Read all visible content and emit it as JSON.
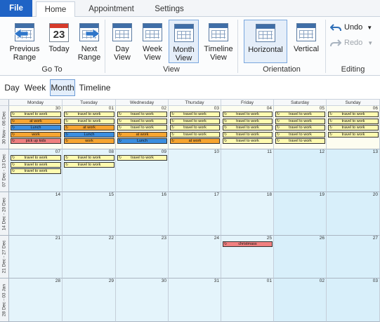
{
  "tabs": {
    "file": "File",
    "home": "Home",
    "appointment": "Appointment",
    "settings": "Settings"
  },
  "ribbon": {
    "goto": {
      "label": "Go To",
      "previous": "Previous Range",
      "today": "Today",
      "today_day": "23",
      "next": "Next Range"
    },
    "view": {
      "label": "View",
      "day": "Day View",
      "week": "Week View",
      "month": "Month View",
      "timeline": "Timeline View"
    },
    "orientation": {
      "label": "Orientation",
      "horizontal": "Horizontal",
      "vertical": "Vertical"
    },
    "editing": {
      "label": "Editing",
      "undo": "Undo",
      "redo": "Redo"
    }
  },
  "switcher": {
    "day": "Day",
    "week": "Week",
    "month": "Month",
    "timeline": "Timeline"
  },
  "calendar": {
    "weekdays": [
      "Monday",
      "Tuesday",
      "Wednesday",
      "Thursday",
      "Friday",
      "Saturday",
      "Sunday"
    ],
    "weeks": [
      {
        "label": "30 Nov - 06 Dec",
        "days": [
          "30",
          "01",
          "02",
          "03",
          "04",
          "05",
          "06"
        ],
        "appts": [
          {
            "day": 0,
            "row": 0,
            "text": "travel to work",
            "color": "#fffbb0"
          },
          {
            "day": 0,
            "row": 1,
            "text": "at work",
            "color": "#f7a531"
          },
          {
            "day": 0,
            "row": 2,
            "text": "Lunch",
            "color": "#3b8ee0"
          },
          {
            "day": 0,
            "row": 3,
            "text": "work",
            "color": "#f7a531"
          },
          {
            "day": 0,
            "row": 4,
            "text": "pick up kids",
            "color": "#f08080"
          },
          {
            "day": 1,
            "row": 0,
            "text": "travel to work",
            "color": "#fffbb0"
          },
          {
            "day": 1,
            "row": 1,
            "text": "travel to work",
            "color": "#fffbb0"
          },
          {
            "day": 1,
            "row": 2,
            "text": "at work",
            "color": "#f7a531"
          },
          {
            "day": 1,
            "row": 3,
            "text": "Lunch",
            "color": "#3b8ee0"
          },
          {
            "day": 1,
            "row": 4,
            "text": "work",
            "color": "#f7a531"
          },
          {
            "day": 2,
            "row": 0,
            "text": "travel to work",
            "color": "#fffbb0"
          },
          {
            "day": 2,
            "row": 1,
            "text": "travel to work",
            "color": "#fffbb0"
          },
          {
            "day": 2,
            "row": 2,
            "text": "travel to work",
            "color": "#fffbb0"
          },
          {
            "day": 2,
            "row": 3,
            "text": "at work",
            "color": "#f7a531"
          },
          {
            "day": 2,
            "row": 4,
            "text": "Lunch",
            "color": "#3b8ee0"
          },
          {
            "day": 3,
            "row": 0,
            "text": "travel to work",
            "color": "#fffbb0"
          },
          {
            "day": 3,
            "row": 1,
            "text": "travel to work",
            "color": "#fffbb0"
          },
          {
            "day": 3,
            "row": 2,
            "text": "travel to work",
            "color": "#fffbb0"
          },
          {
            "day": 3,
            "row": 3,
            "text": "travel to work",
            "color": "#fffbb0"
          },
          {
            "day": 3,
            "row": 4,
            "text": "at work",
            "color": "#f7a531"
          },
          {
            "day": 4,
            "row": 0,
            "text": "travel to work",
            "color": "#fffbb0"
          },
          {
            "day": 4,
            "row": 1,
            "text": "travel to work",
            "color": "#fffbb0"
          },
          {
            "day": 4,
            "row": 2,
            "text": "travel to work",
            "color": "#fffbb0"
          },
          {
            "day": 4,
            "row": 3,
            "text": "travel to work",
            "color": "#fffbb0"
          },
          {
            "day": 4,
            "row": 4,
            "text": "travel to work",
            "color": "#fffbb0"
          },
          {
            "day": 5,
            "row": 0,
            "text": "travel to work",
            "color": "#fffbb0"
          },
          {
            "day": 5,
            "row": 1,
            "text": "travel to work",
            "color": "#fffbb0"
          },
          {
            "day": 5,
            "row": 2,
            "text": "travel to work",
            "color": "#fffbb0"
          },
          {
            "day": 5,
            "row": 3,
            "text": "travel to work",
            "color": "#fffbb0"
          },
          {
            "day": 5,
            "row": 4,
            "text": "travel to work",
            "color": "#fffbb0"
          },
          {
            "day": 6,
            "row": 0,
            "text": "travel to work",
            "color": "#fffbb0"
          },
          {
            "day": 6,
            "row": 1,
            "text": "travel to work",
            "color": "#fffbb0"
          },
          {
            "day": 6,
            "row": 2,
            "text": "travel to work",
            "color": "#fffbb0"
          },
          {
            "day": 6,
            "row": 3,
            "text": "travel to work",
            "color": "#fffbb0"
          }
        ]
      },
      {
        "label": "07 Dec - 13 Dec",
        "days": [
          "07",
          "08",
          "09",
          "10",
          "11",
          "12",
          "13"
        ],
        "appts": [
          {
            "day": 0,
            "row": 0,
            "text": "travel to work",
            "color": "#fffbb0"
          },
          {
            "day": 0,
            "row": 1,
            "text": "travel to work",
            "color": "#fffbb0"
          },
          {
            "day": 0,
            "row": 2,
            "text": "travel to work",
            "color": "#fffbb0"
          },
          {
            "day": 1,
            "row": 0,
            "text": "travel to work",
            "color": "#fffbb0"
          },
          {
            "day": 1,
            "row": 1,
            "text": "travel to work",
            "color": "#fffbb0"
          },
          {
            "day": 2,
            "row": 0,
            "text": "travel to work",
            "color": "#fffbb0"
          }
        ]
      },
      {
        "label": "14 Dec - 20 Dec",
        "days": [
          "14",
          "15",
          "16",
          "17",
          "18",
          "19",
          "20"
        ],
        "appts": []
      },
      {
        "label": "21 Dec - 27 Dec",
        "days": [
          "21",
          "22",
          "23",
          "24",
          "25",
          "26",
          "27"
        ],
        "appts": [
          {
            "day": 4,
            "row": 0,
            "text": "christmass",
            "color": "#f08080"
          }
        ]
      },
      {
        "label": "28 Dec - 03 Jan",
        "days": [
          "28",
          "29",
          "30",
          "31",
          "01",
          "02",
          "03"
        ],
        "appts": []
      }
    ]
  }
}
